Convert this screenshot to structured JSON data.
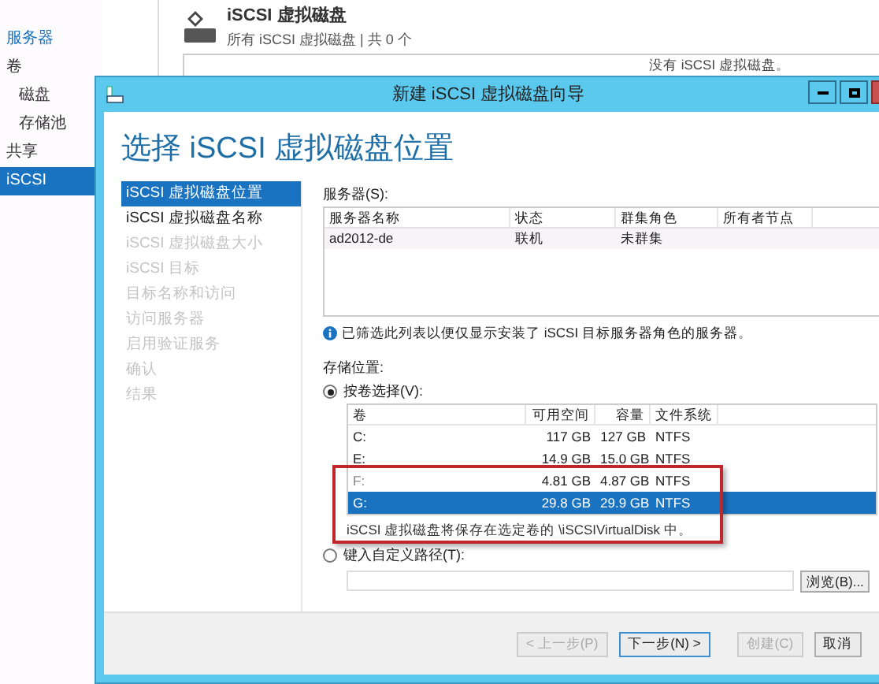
{
  "nav": {
    "items": [
      {
        "label": "服务器",
        "selected": false,
        "link": true
      },
      {
        "label": "卷",
        "selected": false,
        "link": false,
        "children": [
          {
            "label": "磁盘",
            "selected": false
          },
          {
            "label": "存储池",
            "selected": false
          }
        ]
      },
      {
        "label": "共享",
        "selected": false,
        "link": false
      },
      {
        "label": "iSCSI",
        "selected": true,
        "link": false
      }
    ]
  },
  "content": {
    "title": "iSCSI 虚拟磁盘",
    "subtitle": "所有 iSCSI 虚拟磁盘 | 共 0 个",
    "empty_text": "没有 iSCSI 虚拟磁盘。"
  },
  "dialog": {
    "title": "新建 iSCSI 虚拟磁盘向导",
    "heading": "选择 iSCSI 虚拟磁盘位置",
    "steps": [
      {
        "label": "iSCSI 虚拟磁盘位置",
        "selected": true,
        "disabled": false
      },
      {
        "label": "iSCSI 虚拟磁盘名称",
        "selected": false,
        "disabled": false
      },
      {
        "label": "iSCSI 虚拟磁盘大小",
        "selected": false,
        "disabled": true
      },
      {
        "label": "iSCSI 目标",
        "selected": false,
        "disabled": true
      },
      {
        "label": "目标名称和访问",
        "selected": false,
        "disabled": true
      },
      {
        "label": "访问服务器",
        "selected": false,
        "disabled": true
      },
      {
        "label": "启用验证服务",
        "selected": false,
        "disabled": true
      },
      {
        "label": "确认",
        "selected": false,
        "disabled": true
      },
      {
        "label": "结果",
        "selected": false,
        "disabled": true
      }
    ],
    "servers_label": "服务器(S):",
    "server_columns": [
      "服务器名称",
      "状态",
      "群集角色",
      "所有者节点"
    ],
    "server_rows": [
      {
        "cells": [
          "ad2012-de",
          "联机",
          "未群集"
        ],
        "selected": false
      }
    ],
    "info": "已筛选此列表以便仅显示安装了 iSCSI 目标服务器角色的服务器。",
    "storage_label": "存储位置:",
    "options": [
      {
        "label": "按卷选择(V):",
        "selected": true
      },
      {
        "label": "键入自定义路径(T):",
        "selected": false
      }
    ],
    "volume_columns": [
      "卷",
      "可用空间",
      "容量",
      "文件系统"
    ],
    "volume_rows": [
      {
        "cells": [
          "C:",
          "117 GB",
          "127 GB",
          "NTFS"
        ],
        "selected": false,
        "marked": false
      },
      {
        "cells": [
          "E:",
          "14.9 GB",
          "15.0 GB",
          "NTFS"
        ],
        "selected": false,
        "marked": false
      },
      {
        "cells": [
          "F:",
          "4.81 GB",
          "4.87 GB",
          "NTFS"
        ],
        "selected": false,
        "marked": true
      },
      {
        "cells": [
          "G:",
          "29.8 GB",
          "29.9 GB",
          "NTFS"
        ],
        "selected": true,
        "marked": true
      }
    ],
    "note": "iSCSI 虚拟磁盘将保存在选定卷的 \\iSCSIVirtualDisk 中。",
    "browse": "浏览(B)...",
    "buttons": [
      {
        "label": "< 上一步(P)",
        "disabled": true,
        "default": false
      },
      {
        "label": "下一步(N) >",
        "disabled": false,
        "default": true
      },
      {
        "label": "创建(C)",
        "disabled": true,
        "default": false
      },
      {
        "label": "取消",
        "disabled": false,
        "default": false
      }
    ]
  }
}
